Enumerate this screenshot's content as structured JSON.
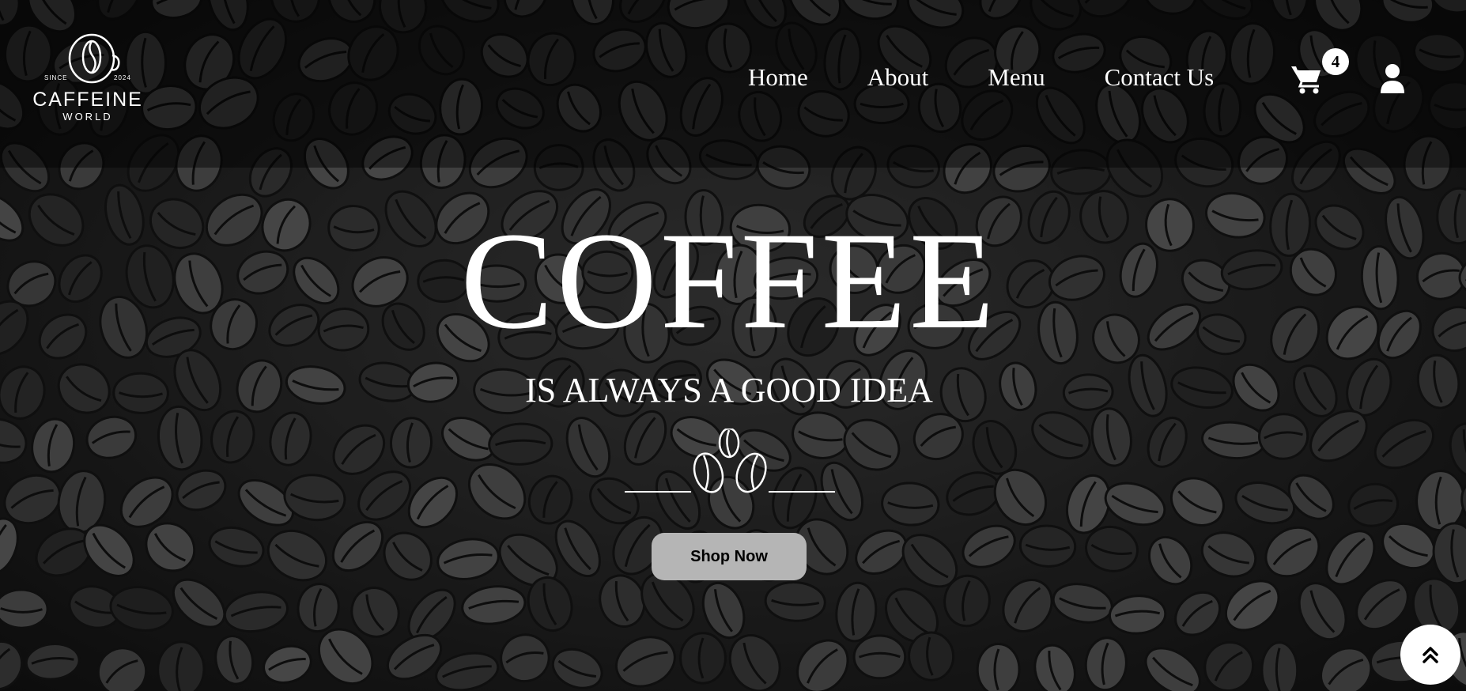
{
  "brand": {
    "since": "SINCE",
    "year": "2024",
    "name": "CAFFEINE",
    "sub": "WORLD"
  },
  "nav": {
    "items": [
      {
        "label": "Home"
      },
      {
        "label": "About"
      },
      {
        "label": "Menu"
      },
      {
        "label": "Contact Us"
      }
    ]
  },
  "cart": {
    "count": "4",
    "icon": "shopping-cart-icon"
  },
  "user": {
    "icon": "user-icon"
  },
  "hero": {
    "headline": "COFFEE",
    "subheadline": "IS ALWAYS A GOOD IDEA",
    "divider_icon": "coffee-beans-icon",
    "cta_label": "Shop Now"
  },
  "scroll_top": {
    "icon": "double-chevron-up-icon"
  },
  "colors": {
    "text": "#ffffff",
    "header_overlay": "rgba(0,0,0,0.45)",
    "button_bg": "#b5b5b5",
    "badge_bg": "#ffffff"
  }
}
